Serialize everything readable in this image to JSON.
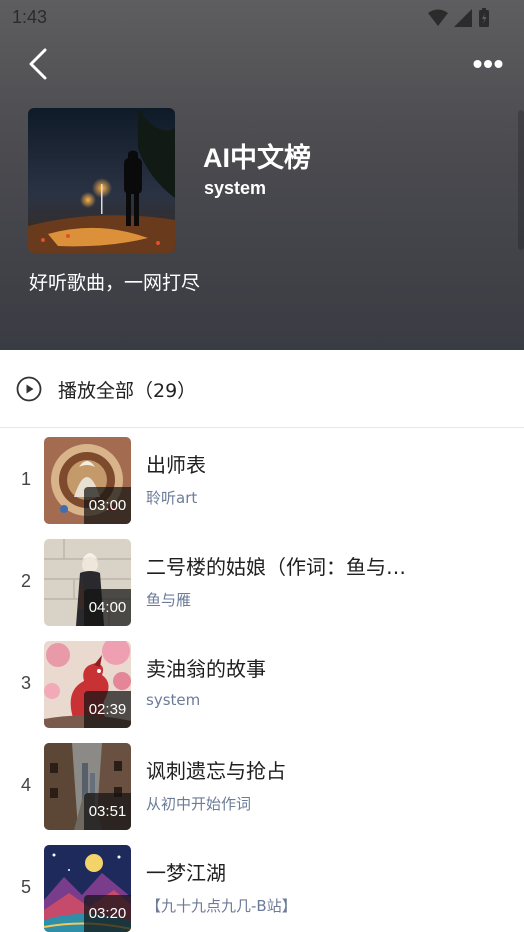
{
  "status_bar": {
    "time": "1:43"
  },
  "header": {
    "title": "AI中文榜",
    "author": "system",
    "description": "好听歌曲，一网打尽",
    "icons": {
      "back": "back-arrow-icon",
      "more": "more-dots-icon"
    }
  },
  "play_all": {
    "label": "播放全部（29）",
    "icon": "play-circle-icon"
  },
  "songs": [
    {
      "index": "1",
      "title": "出师表",
      "artist": "聆听art",
      "duration": "03:00"
    },
    {
      "index": "2",
      "title": "二号楼的姑娘（作词：鱼与…",
      "artist": "鱼与雁",
      "duration": "04:00"
    },
    {
      "index": "3",
      "title": "卖油翁的故事",
      "artist": "system",
      "duration": "02:39"
    },
    {
      "index": "4",
      "title": "讽刺遗忘与抢占",
      "artist": "从初中开始作词",
      "duration": "03:51"
    },
    {
      "index": "5",
      "title": "一梦江湖",
      "artist": "【九十九点九几-B站】",
      "duration": "03:20"
    }
  ],
  "colors": {
    "header_top": "#5e5d5f",
    "header_bottom": "#3a3c43",
    "artist_text": "#6c7b98"
  }
}
